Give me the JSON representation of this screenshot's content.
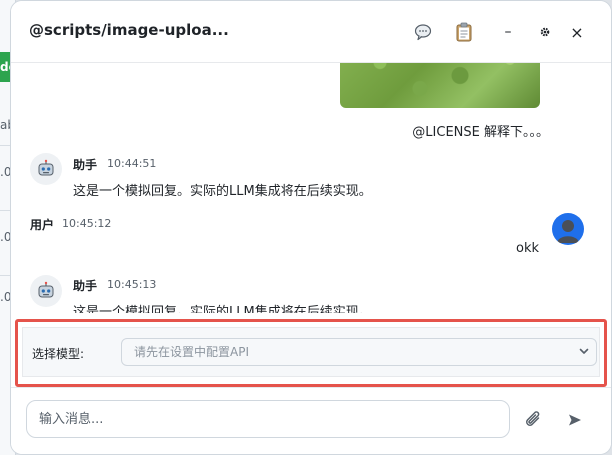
{
  "background_app": {
    "cells": [
      "de",
      "ab",
      ".0",
      ".0",
      ".0"
    ]
  },
  "header": {
    "title": "@scripts/image-uploa...",
    "chat_icon": "chat-bubble-icon",
    "clipboard_icon": "clipboard-icon",
    "minimize_label": "–",
    "settings_icon": "gear-icon",
    "close_label": "×"
  },
  "messages": [
    {
      "role": "user",
      "text": "@LICENSE 解释下。。。",
      "has_image": true
    },
    {
      "role": "assistant",
      "sender": "助手",
      "time": "10:44:51",
      "text": "这是一个模拟回复。实际的LLM集成将在后续实现。"
    },
    {
      "role": "user",
      "sender": "用户",
      "time": "10:45:12",
      "text": "okk"
    },
    {
      "role": "assistant",
      "sender": "助手",
      "time": "10:45:13",
      "text": "这是一个模拟回复。实际的LLM集成将在后续实现。"
    }
  ],
  "model_selector": {
    "label": "选择模型:",
    "selected": "请先在设置中配置API"
  },
  "input": {
    "placeholder": "输入消息..."
  },
  "colors": {
    "highlight_border": "#e5534b",
    "user_avatar": "#1f6feb",
    "text": "#1f2328",
    "muted": "#57606a"
  }
}
